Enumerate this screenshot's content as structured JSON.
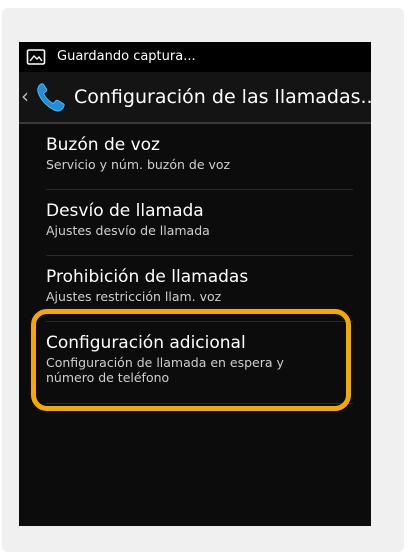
{
  "status_bar": {
    "icon": "screenshot-icon",
    "text": "Guardando captura..."
  },
  "action_bar": {
    "back_icon": "chevron-left-icon",
    "app_icon": "phone-icon",
    "title": "Configuración de las llamadas..."
  },
  "settings": {
    "items": [
      {
        "title": "Buzón de voz",
        "subtitle": "Servicio y núm. buzón de voz"
      },
      {
        "title": "Desvío de llamada",
        "subtitle": "Ajustes desvío de llamada"
      },
      {
        "title": "Prohibición de llamadas",
        "subtitle": "Ajustes restricción llam. voz"
      },
      {
        "title": "Configuración adicional",
        "subtitle_line1": "Configuración de llamada en espera y",
        "subtitle_line2": "número de teléfono"
      }
    ]
  },
  "colors": {
    "highlight": "#f2a900",
    "phone_icon": "#1e8fd8",
    "background": "#0c0c0c"
  }
}
